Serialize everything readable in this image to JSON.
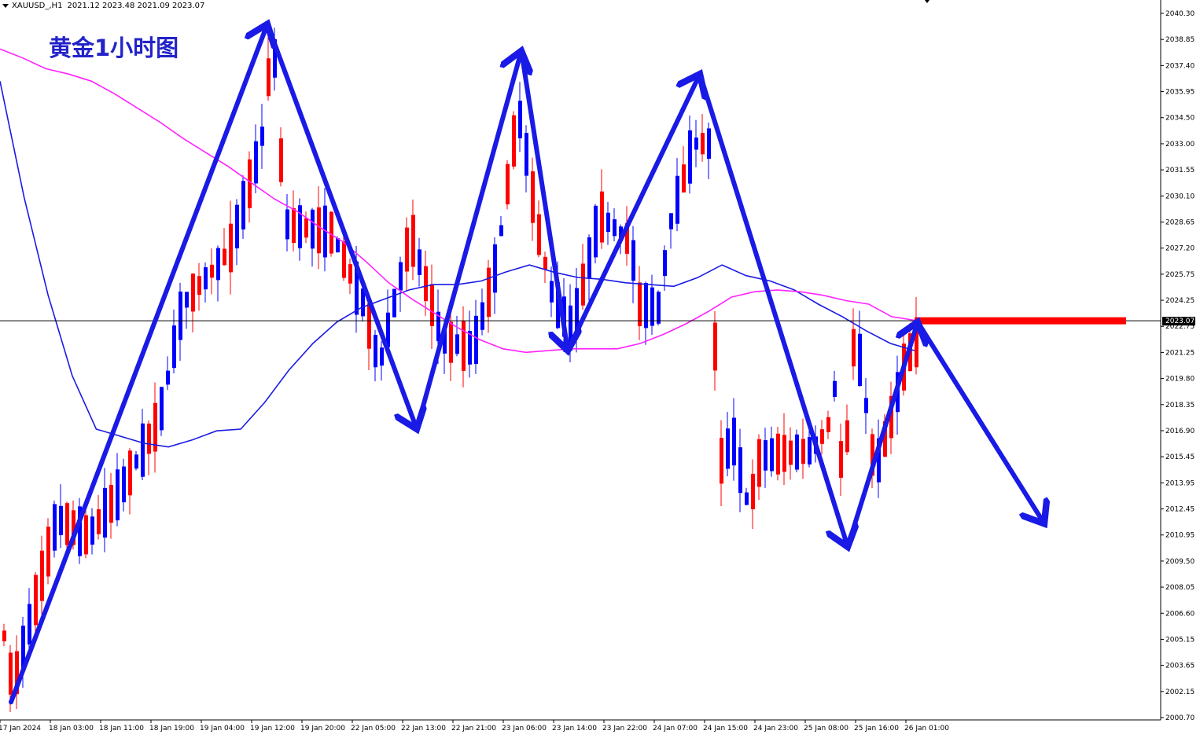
{
  "header": {
    "symbol": "XAUUSD_,H1",
    "ohlc": "2021.12 2023.48 2021.09 2023.07"
  },
  "annotation_title": "黄金1小时图",
  "colors": {
    "bull": "#ff0000",
    "bear": "#0000ff",
    "ma_fast": "#1a1ae6",
    "ma_slow": "#ff22ff",
    "arrow": "#1a1ae6",
    "resistance": "#ff0000",
    "price_tag": "#000000"
  },
  "chart_data": {
    "type": "candlestick",
    "timeframe": "H1",
    "y_range": [
      2000.0,
      2040.6
    ],
    "y_ticks": [
      "2040.30",
      "2038.85",
      "2037.40",
      "2035.95",
      "2034.50",
      "2033.00",
      "2031.55",
      "2030.10",
      "2028.65",
      "2027.20",
      "2025.75",
      "2024.25",
      "2022.75",
      "2021.25",
      "2019.80",
      "2018.35",
      "2016.90",
      "2015.45",
      "2013.95",
      "2012.45",
      "2010.95",
      "2009.50",
      "2008.05",
      "2006.60",
      "2005.15",
      "2003.65",
      "2002.15",
      "2000.70"
    ],
    "x_tick_labels": [
      "17 Jan 2024",
      "18 Jan 03:00",
      "18 Jan 11:00",
      "18 Jan 19:00",
      "19 Jan 04:00",
      "19 Jan 12:00",
      "19 Jan 20:00",
      "22 Jan 05:00",
      "22 Jan 13:00",
      "22 Jan 21:00",
      "23 Jan 06:00",
      "23 Jan 14:00",
      "23 Jan 22:00",
      "24 Jan 07:00",
      "24 Jan 15:00",
      "24 Jan 23:00",
      "25 Jan 08:00",
      "25 Jan 16:00",
      "26 Jan 01:00"
    ],
    "current_price": "2023.07",
    "resistance_level": 2023.07,
    "series_fast_ma": [
      2036.5,
      2030,
      2024.5,
      2020,
      2017,
      2016.6,
      2016.2,
      2016.0,
      2016.4,
      2016.9,
      2017.0,
      2018.5,
      2020.3,
      2021.8,
      2023.0,
      2023.8,
      2024.3,
      2024.8,
      2025.1,
      2025.1,
      2025.3,
      2025.8,
      2026.2,
      2025.8,
      2025.5,
      2025.4,
      2025.2,
      2025.1,
      2025.0,
      2025.5,
      2026.2,
      2025.6,
      2025.3,
      2024.8,
      2024.0,
      2023.3,
      2022.5,
      2021.8,
      2021.4
    ],
    "series_slow_ma": [
      2038.3,
      2037.8,
      2037.2,
      2036.9,
      2036.5,
      2035.8,
      2035.0,
      2034.2,
      2033.3,
      2032.5,
      2031.7,
      2030.8,
      2029.9,
      2029.2,
      2028.3,
      2027.5,
      2026.4,
      2025.2,
      2024.3,
      2023.5,
      2022.7,
      2022.0,
      2021.5,
      2021.3,
      2021.4,
      2021.5,
      2021.5,
      2021.5,
      2021.8,
      2022.3,
      2022.9,
      2023.6,
      2024.4,
      2024.7,
      2024.8,
      2024.7,
      2024.5,
      2024.2,
      2024.0,
      2023.3,
      2023.1
    ],
    "pattern_arrows_price": [
      [
        2001.7,
        2039.7
      ],
      [
        2039.7,
        2017.0
      ],
      [
        2017.0,
        2038.2
      ],
      [
        2038.2,
        2021.4
      ],
      [
        2021.4,
        2036.9
      ],
      [
        2036.9,
        2010.4
      ],
      [
        2010.4,
        2023.0
      ],
      [
        2023.0,
        2011.7
      ]
    ]
  }
}
